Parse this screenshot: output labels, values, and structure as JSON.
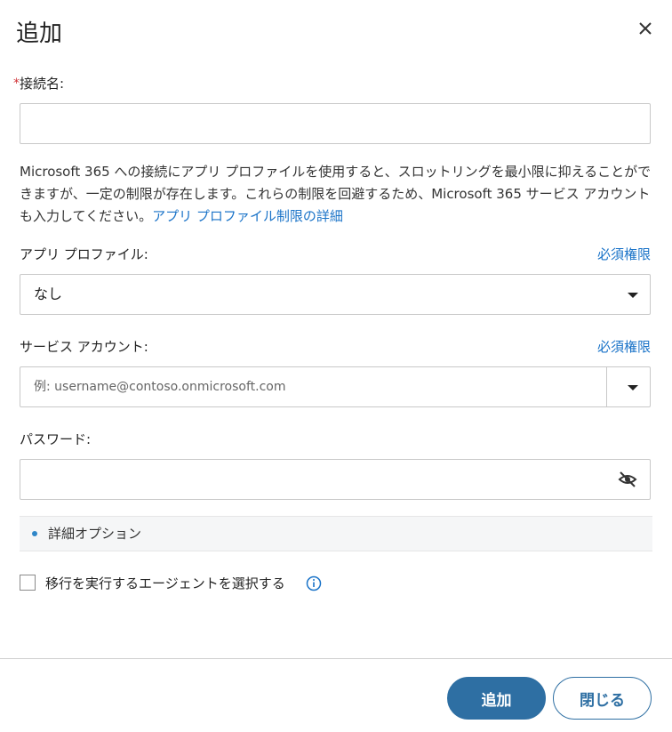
{
  "dialog": {
    "title": "追加"
  },
  "connection_name": {
    "label": "接続名:",
    "value": ""
  },
  "description": {
    "text": "Microsoft 365 への接続にアプリ プロファイルを使用すると、スロットリングを最小限に抑えることができますが、一定の制限が存在します。これらの制限を回避するため、Microsoft 365 サービス アカウントも入力してください。",
    "link": "アプリ プロファイル制限の詳細"
  },
  "app_profile": {
    "label": "アプリ プロファイル:",
    "permissions_link": "必須権限",
    "selected": "なし"
  },
  "service_account": {
    "label": "サービス アカウント:",
    "permissions_link": "必須権限",
    "placeholder": "例: username@contoso.onmicrosoft.com"
  },
  "password": {
    "label": "パスワード:",
    "value": ""
  },
  "advanced": {
    "label": "詳細オプション"
  },
  "agent_select": {
    "label": "移行を実行するエージェントを選択する",
    "checked": false
  },
  "footer": {
    "add_label": "追加",
    "close_label": "閉じる"
  },
  "colors": {
    "primary": "#2e6fa3",
    "link": "#1a73c8",
    "required": "#d13438"
  },
  "icons": {
    "close": "close-icon",
    "dropdown": "chevron-down-icon",
    "eye": "eye-slash-icon",
    "info": "info-icon"
  }
}
